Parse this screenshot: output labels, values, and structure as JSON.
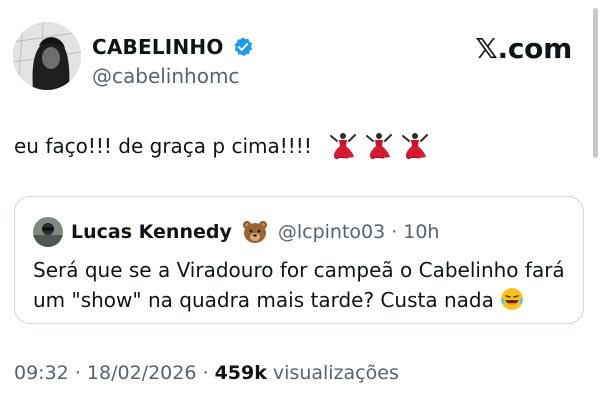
{
  "author": {
    "display_name": "CABELINHO",
    "handle": "@cabelinhomc",
    "verified_color": "#1d9bf0"
  },
  "brand": "𝕏.com",
  "tweet": {
    "text": "eu faço!!! de graça p cima!!!!",
    "emoji": [
      "dancer-icon",
      "dancer-icon",
      "dancer-icon"
    ]
  },
  "quote": {
    "display_name": "Lucas Kennedy",
    "name_emoji": "bear-face-icon",
    "handle": "@lcpinto03",
    "separator": "·",
    "time": "10h",
    "text": "Será que se a  Viradouro for campeã o Cabelinho fará um \"show\" na quadra mais tarde? Custa nada",
    "trailing_emoji": "tears-of-joy-icon"
  },
  "meta": {
    "time": "09:32",
    "separator": "·",
    "date": "18/02/2026",
    "views_count": "459k",
    "views_label": "visualizações"
  },
  "colors": {
    "text": "#0f1419",
    "secondary": "#536471",
    "border": "#cfd9de"
  }
}
